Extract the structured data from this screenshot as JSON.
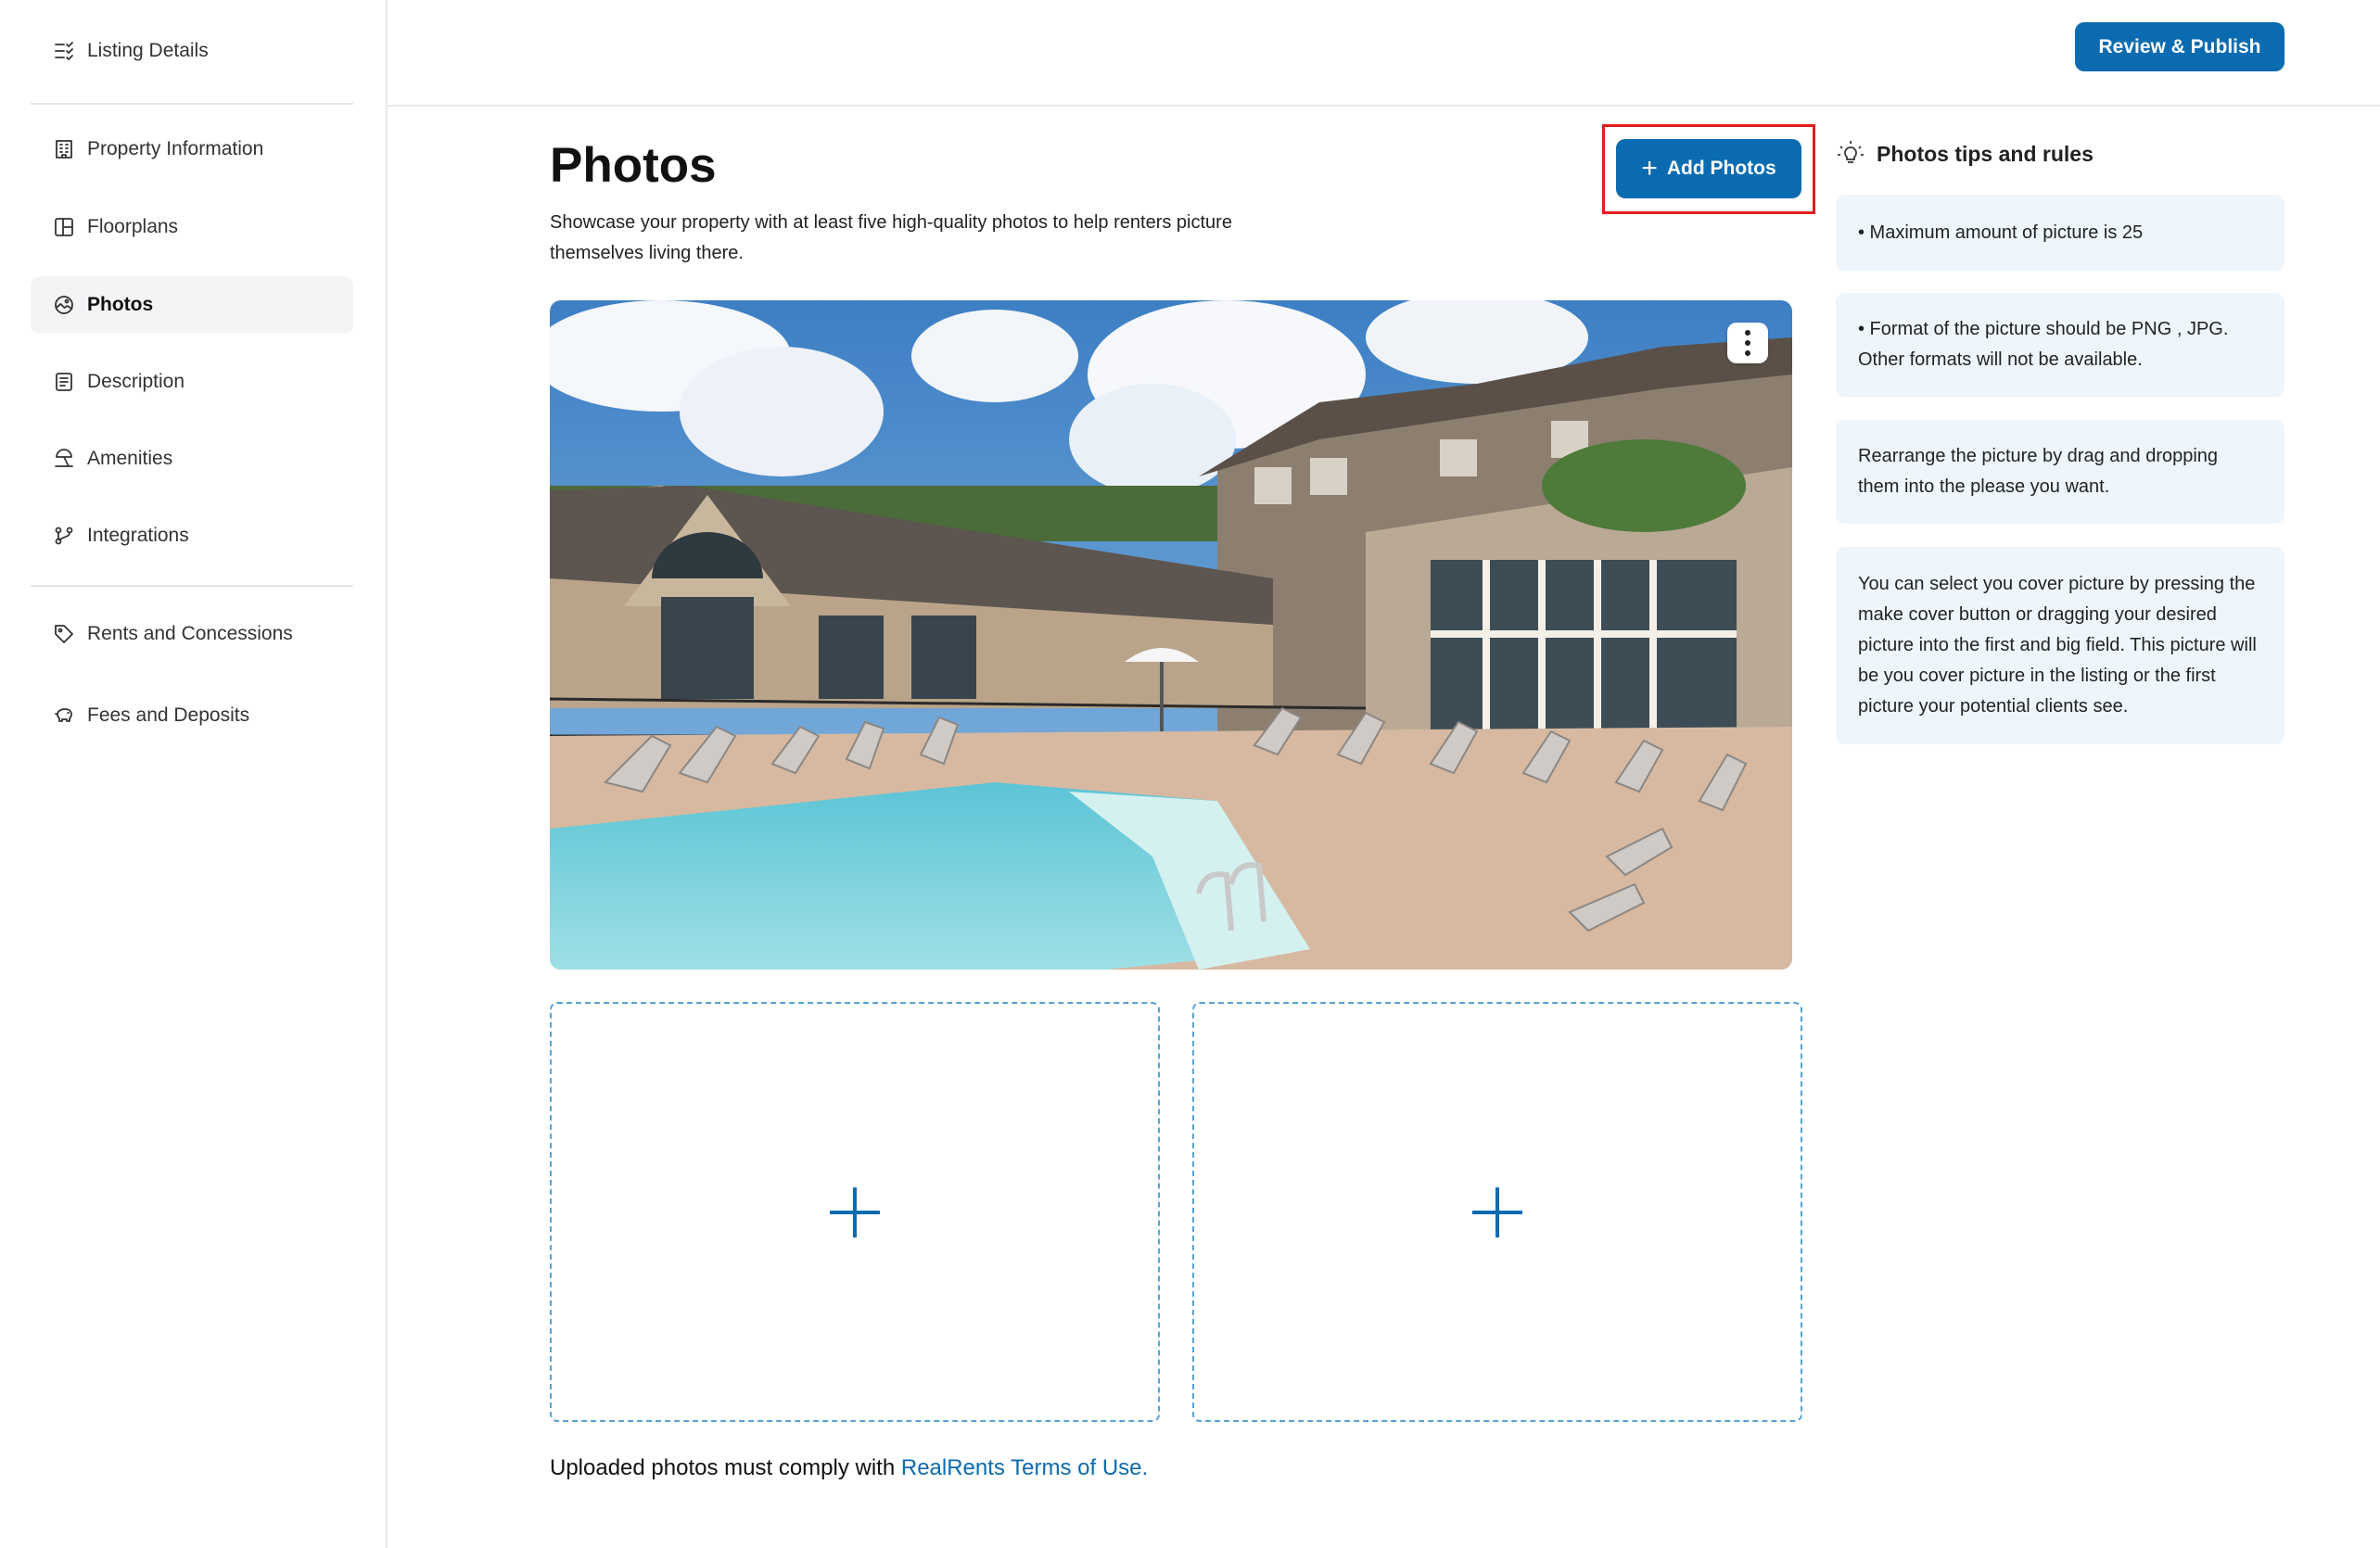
{
  "sidebar": {
    "header": {
      "label": "Listing Details"
    },
    "items": [
      {
        "label": "Property Information",
        "icon": "building-icon"
      },
      {
        "label": "Floorplans",
        "icon": "floorplan-icon"
      },
      {
        "label": "Photos",
        "icon": "photos-icon",
        "active": true
      },
      {
        "label": "Description",
        "icon": "description-icon"
      },
      {
        "label": "Amenities",
        "icon": "amenities-icon"
      },
      {
        "label": "Integrations",
        "icon": "integrations-icon"
      }
    ],
    "extra_items": [
      {
        "label": "Rents and Concessions",
        "icon": "tag-icon"
      },
      {
        "label": "Fees and Deposits",
        "icon": "piggy-bank-icon"
      }
    ]
  },
  "topbar": {
    "review_publish_label": "Review & Publish"
  },
  "main": {
    "title": "Photos",
    "description": "Showcase your property with at least five high-quality photos to help renters picture themselves living there.",
    "add_photos_label": "Add Photos",
    "terms_prefix": "Uploaded photos must comply with ",
    "terms_link": "RealRents Terms of Use."
  },
  "tips": {
    "title": "Photos tips and rules",
    "items": [
      "• Maximum amount of picture is 25",
      "• Format of the picture should be PNG , JPG. Other formats will not be available.",
      "Rearrange the picture by drag and dropping them into the please you want.",
      "You can select you cover picture by pressing the make cover button or dragging your desired picture into the first and big field. This picture will be you cover picture in the listing or the first picture your potential clients see."
    ]
  },
  "colors": {
    "accent": "#0b6bb0",
    "highlight": "#e11d1d",
    "tip_background": "#eef6fc"
  }
}
